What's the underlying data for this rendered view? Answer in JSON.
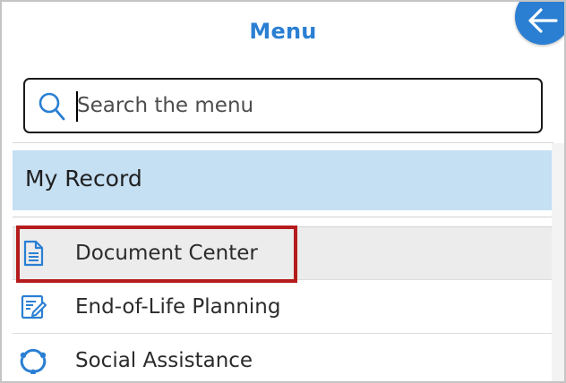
{
  "header": {
    "title": "Menu",
    "back_icon": "arrow-left-icon",
    "accent_color": "#2a7fd3"
  },
  "search": {
    "placeholder": "Search the menu",
    "value": "",
    "icon": "search-icon"
  },
  "section": {
    "title": "My Record",
    "background": "#c5dff3"
  },
  "menu_items": [
    {
      "label": "Document Center",
      "icon": "document-icon",
      "selected": true
    },
    {
      "label": "End-of-Life Planning",
      "icon": "edit-form-icon",
      "selected": false
    },
    {
      "label": "Social Assistance",
      "icon": "social-network-icon",
      "selected": false
    }
  ],
  "highlight_color": "#b51b1b"
}
